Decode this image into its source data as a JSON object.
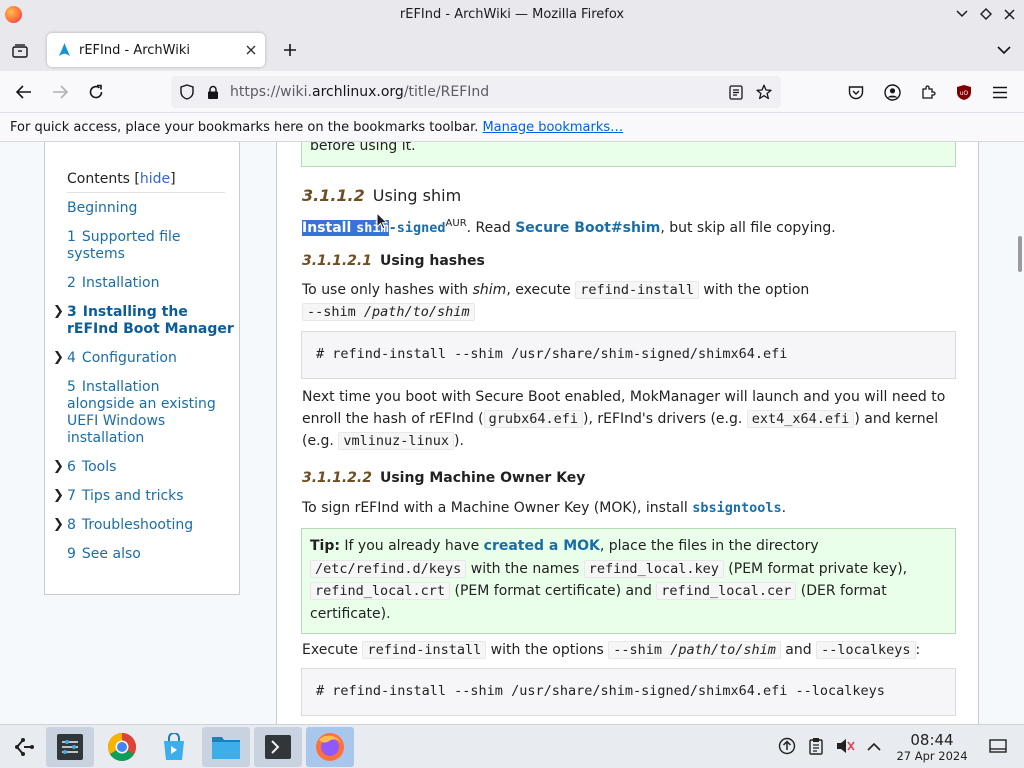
{
  "window": {
    "title": "rEFInd - ArchWiki — Mozilla Firefox"
  },
  "tab": {
    "title": "rEFInd - ArchWiki"
  },
  "urlbar": {
    "url_prefix": "https://wiki.",
    "url_domain": "archlinux.org",
    "url_path": "/title/REFInd"
  },
  "bookmarks_bar": {
    "message": "For quick access, place your bookmarks here on the bookmarks toolbar.",
    "link": "Manage bookmarks…"
  },
  "toc": {
    "title": "Contents",
    "toggle": "hide",
    "items": [
      {
        "num": "",
        "label": "Beginning"
      },
      {
        "num": "1",
        "label": "Supported file"
      },
      {
        "num": "",
        "label": "systems"
      },
      {
        "num": "2",
        "label": "Installation"
      },
      {
        "num": "3",
        "label": "Installing the"
      },
      {
        "num": "",
        "label": "rEFInd Boot Manager"
      },
      {
        "num": "4",
        "label": "Configuration"
      },
      {
        "num": "5",
        "label": "Installation"
      },
      {
        "num": "",
        "label": "alongside an existing"
      },
      {
        "num": "",
        "label": "UEFI Windows"
      },
      {
        "num": "",
        "label": "installation"
      },
      {
        "num": "6",
        "label": "Tools"
      },
      {
        "num": "7",
        "label": "Tips and tricks"
      },
      {
        "num": "8",
        "label": "Troubleshooting"
      },
      {
        "num": "9",
        "label": "See also"
      }
    ]
  },
  "article": {
    "top_note": "before using it.",
    "s1": {
      "num": "3.1.1.2",
      "title": "Using shim"
    },
    "p1": {
      "install": "Install ",
      "pkg_sel": "shim",
      "pkg_rest": "-signed",
      "aur": "AUR",
      "read": ". Read ",
      "link": "Secure Boot#shim",
      "rest": ", but skip all file copying."
    },
    "s2": {
      "num": "3.1.1.2.1",
      "title": "Using hashes"
    },
    "p2": {
      "a": "To use only hashes with ",
      "shim": "shim",
      "b": ", execute ",
      "code1": "refind-install",
      "c": " with the option",
      "code2": "--shim ",
      "code2i": "/path/to/shim"
    },
    "cmd1": "# refind-install --shim /usr/share/shim-signed/shimx64.efi",
    "p3": {
      "a": "Next time you boot with Secure Boot enabled, MokManager will launch and you will need to",
      "b": "enroll the hash of rEFInd (",
      "code1": "grubx64.efi",
      "c": "), rEFInd's drivers (e.g. ",
      "code2": "ext4_x64.efi",
      "d": ") and kernel",
      "e": "(e.g. ",
      "code3": "vmlinuz-linux",
      "f": ")."
    },
    "s3": {
      "num": "3.1.1.2.2",
      "title": "Using Machine Owner Key"
    },
    "p4": {
      "a": "To sign rEFInd with a Machine Owner Key (MOK), install ",
      "pkg": "sbsigntools",
      "b": "."
    },
    "tip": {
      "label": "Tip:",
      "a": " If you already have ",
      "link": "created a MOK",
      "b": ", place the files in the directory",
      "code1": "/etc/refind.d/keys",
      "c": " with the names ",
      "code2": "refind_local.key",
      "d": " (PEM format private key),",
      "code3": "refind_local.crt",
      "e": " (PEM format certificate) and ",
      "code4": "refind_local.cer",
      "f": " (DER format",
      "g": "certificate)."
    },
    "p5": {
      "a": "Execute ",
      "code1": "refind-install",
      "b": " with the options ",
      "code2": "--shim ",
      "code2i": "/path/to/shim",
      "c": " and ",
      "code3": "--localkeys",
      "d": ":"
    },
    "cmd2": "# refind-install --shim /usr/share/shim-signed/shimx64.efi --localkeys"
  },
  "taskbar": {
    "apps": [
      "application-launcher",
      "system-settings",
      "chrome",
      "discover-store",
      "file-manager",
      "terminal",
      "firefox"
    ],
    "time": "08:44",
    "date": "27 Apr 2024"
  },
  "colors": {
    "link": "#1a6ea8",
    "tip_bg": "#eaffea",
    "section_num": "#6e4f23",
    "selection": "#3874d8"
  }
}
